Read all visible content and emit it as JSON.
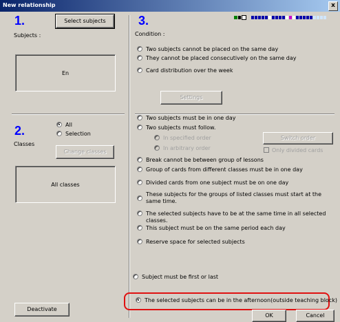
{
  "window": {
    "title": "New relationship",
    "close": "x"
  },
  "section1": {
    "number": "1.",
    "select_button": "Select subjects",
    "subjects_label": "Subjects :",
    "subjects_value": "En"
  },
  "section2": {
    "number": "2.",
    "classes_label": "Classes",
    "opt_all": "All",
    "opt_selection": "Selection",
    "change_button": "Change classes",
    "classes_value": "All classes"
  },
  "section3": {
    "number": "3.",
    "condition_label": "Condition :"
  },
  "options": {
    "o1": "Two subjects cannot be placed on the same day",
    "o2": "They cannot be placed consecutively on the same day",
    "o3": "Card distribution over the week",
    "settings": "Settings",
    "o4": "Two subjects must be in one day",
    "o5": "Two subjects must follow.",
    "o5a": "In specified order",
    "o5b": "In arbitrary order",
    "switch_order": "Switch order",
    "only_divided": "Only divided cards",
    "o6": "Break cannot be between group of lessons",
    "o7": "Group of cards from different classes must be in one day",
    "o8": "Divided cards from one subject must be on one day",
    "o9": "These subjects for the groups of listed classes must start at the same time.",
    "o10": "The selected subjects have to be at the same time in all selected classes.",
    "o11": "This subject must be on the same period each day",
    "o12": "Reserve space for selected subjects",
    "o13": "Subject must be first or last",
    "o14": "The selected subjects can be in the afternoon(outside teaching block)"
  },
  "buttons": {
    "deactivate": "Deactivate",
    "ok": "OK",
    "cancel": "Cancel"
  },
  "colors": {
    "accent_number": "#0000ff",
    "highlight": "#e01010"
  }
}
